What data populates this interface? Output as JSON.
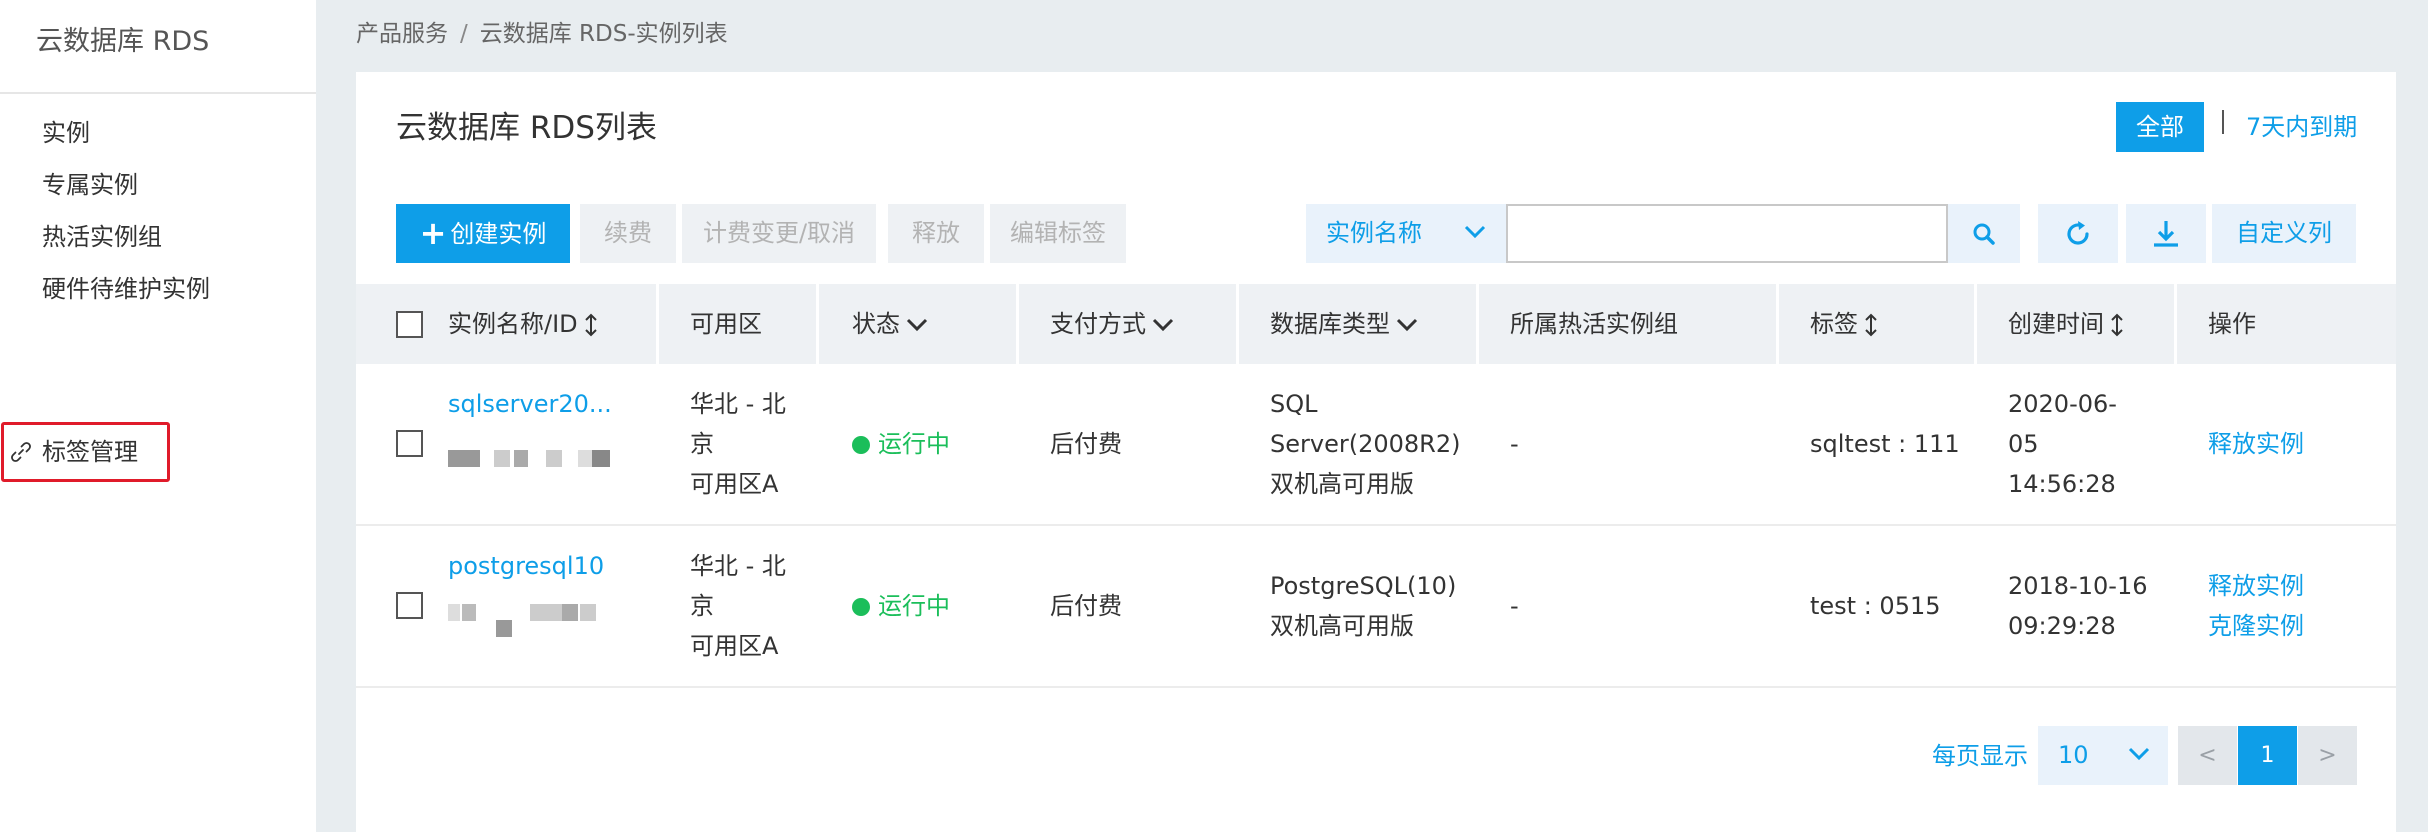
{
  "sidebar": {
    "title": "云数据库 RDS",
    "items": [
      {
        "label": "实例"
      },
      {
        "label": "专属实例"
      },
      {
        "label": "热活实例组"
      },
      {
        "label": "硬件待维护实例"
      },
      {
        "label": "标签管理",
        "icon": "link-icon",
        "highlighted": true
      }
    ]
  },
  "breadcrumb": {
    "parent": "产品服务",
    "separator": "/",
    "current": "云数据库 RDS-实例列表"
  },
  "page": {
    "title": "云数据库 RDS列表"
  },
  "filters": {
    "all": "全部",
    "separator": "|",
    "expiring": "7天内到期"
  },
  "toolbar": {
    "create": "创建实例",
    "renew": "续费",
    "billing_change": "计费变更/取消",
    "release": "释放",
    "edit_tags": "编辑标签",
    "search_field": "实例名称",
    "search_placeholder": "",
    "custom_columns": "自定义列"
  },
  "table": {
    "headers": {
      "name": "实例名称/ID",
      "zone": "可用区",
      "status": "状态",
      "payment": "支付方式",
      "db_type": "数据库类型",
      "hot_group": "所属热活实例组",
      "tags": "标签",
      "created": "创建时间",
      "actions": "操作"
    },
    "rows": [
      {
        "name": "sqlserver20...",
        "zone_l1": "华北 - 北",
        "zone_l2": "京",
        "zone_l3": "可用区A",
        "status": "运行中",
        "payment": "后付费",
        "db_l1": "SQL",
        "db_l2": "Server(2008R2)",
        "db_l3": "双机高可用版",
        "hot_group": "-",
        "tags": "sqltest : 111",
        "created_l1": "2020-06-",
        "created_l2": "05",
        "created_l3": "14:56:28",
        "action_1": "释放实例"
      },
      {
        "name": "postgresql10",
        "zone_l1": "华北 - 北",
        "zone_l2": "京",
        "zone_l3": "可用区A",
        "status": "运行中",
        "payment": "后付费",
        "db_l1": "PostgreSQL(10)",
        "db_l2": "双机高可用版",
        "hot_group": "-",
        "tags": "test : 0515",
        "created_l1": "2018-10-16",
        "created_l2": "09:29:28",
        "action_1": "释放实例",
        "action_2": "克隆实例"
      }
    ]
  },
  "pagination": {
    "per_page_label": "每页显示",
    "page_size": "10",
    "prev": "<",
    "current": "1",
    "next": ">"
  },
  "colors": {
    "primary": "#0e9ee8",
    "running": "#1bbe5a",
    "highlight": "#e01b2a"
  }
}
